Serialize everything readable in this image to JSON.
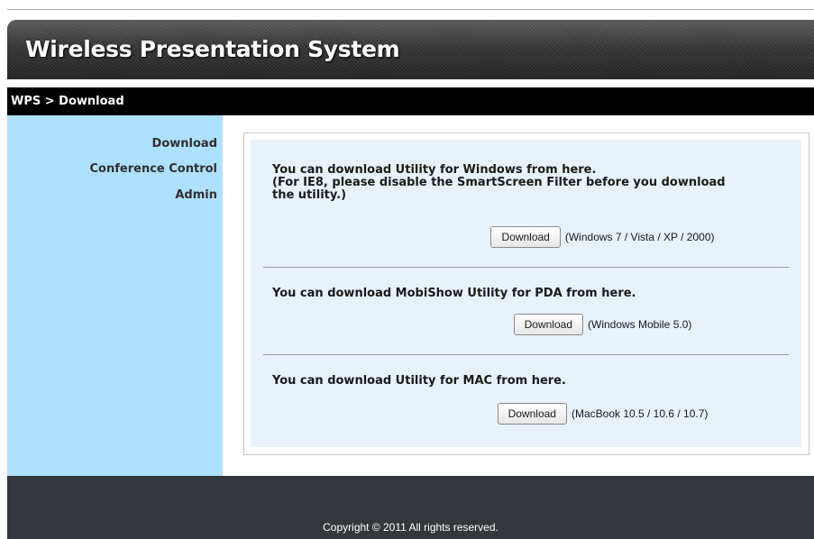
{
  "header": {
    "title": "Wireless Presentation System"
  },
  "breadcrumb": {
    "text": "WPS > Download"
  },
  "sidebar": {
    "items": [
      {
        "label": "Download"
      },
      {
        "label": "Conference Control"
      },
      {
        "label": "Admin"
      }
    ]
  },
  "sections": [
    {
      "lines": [
        "You can download Utility for Windows from here.",
        "(For IE8, please disable the SmartScreen Filter before you download",
        "the utility.)"
      ],
      "button_label": "Download",
      "note": "(Windows 7 / Vista / XP / 2000)"
    },
    {
      "lines": [
        "You can download MobiShow Utility for PDA from here."
      ],
      "button_label": "Download",
      "note": "(Windows Mobile 5.0)"
    },
    {
      "lines": [
        "You can download Utility for MAC from here."
      ],
      "button_label": "Download",
      "note": "(MacBook 10.5 / 10.6 / 10.7)"
    }
  ],
  "footer": {
    "copyright": "Copyright © 2011 All rights reserved."
  },
  "colors": {
    "sidebar_bg": "#aee0ff",
    "panel_bg": "#e9f1fb",
    "breadcrumb_bg": "#000000",
    "footer_bg": "#34383c"
  }
}
